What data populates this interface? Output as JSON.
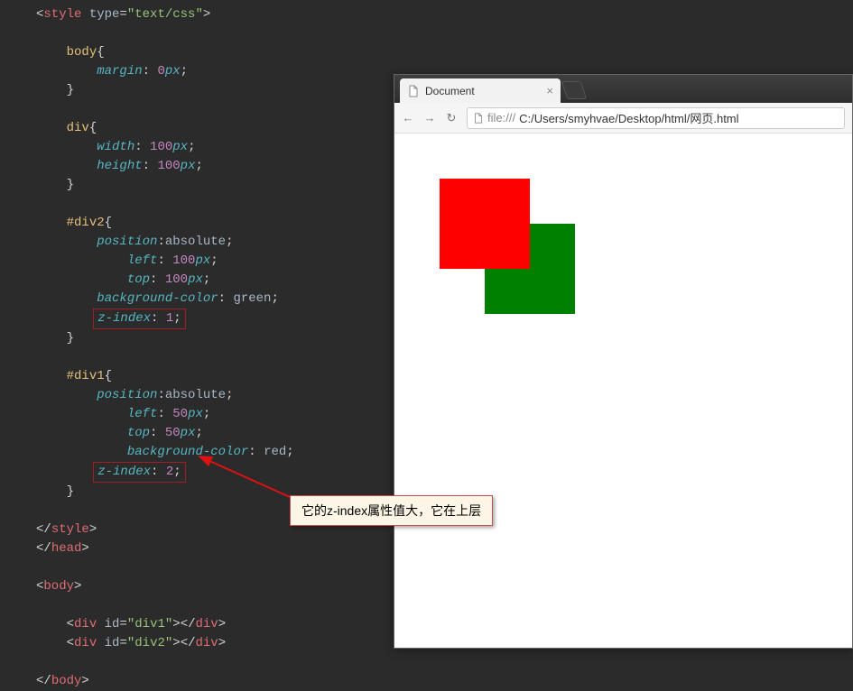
{
  "code": {
    "l1_open": "<",
    "l1_tag": "style",
    "l1_sp": " ",
    "l1_attr": "type",
    "l1_eq": "=",
    "l1_str": "\"text/css\"",
    "l1_close": ">",
    "sel_body": "body",
    "brace_open": "{",
    "brace_close": "}",
    "p_margin": "margin",
    "v_0px": "0",
    "u_px": "px",
    "semi": ";",
    "sel_div": "div",
    "p_width": "width",
    "p_height": "height",
    "v_100": "100",
    "sel_div2": "#div2",
    "p_position": "position",
    "v_absolute": "absolute",
    "p_left": "left",
    "p_top": "top",
    "p_bg": "background-color",
    "v_green": "green",
    "p_z": "z-index",
    "v_1": "1",
    "sel_div1": "#div1",
    "v_50": "50",
    "v_red": "red",
    "v_2": "2",
    "close_style_open": "</",
    "close_style_tag": "style",
    "gt": ">",
    "close_head_tag": "head",
    "open_body_tag": "body",
    "div_tag": "div",
    "id_attr": "id",
    "id_div1": "\"div1\"",
    "id_div2": "\"div2\""
  },
  "browser": {
    "tab_title": "Document",
    "url_prefix": "file:///",
    "url_rest": "C:/Users/smyhvae/Desktop/html/网页.html"
  },
  "annotation": {
    "text": "它的z-index属性值大，它在上层"
  }
}
